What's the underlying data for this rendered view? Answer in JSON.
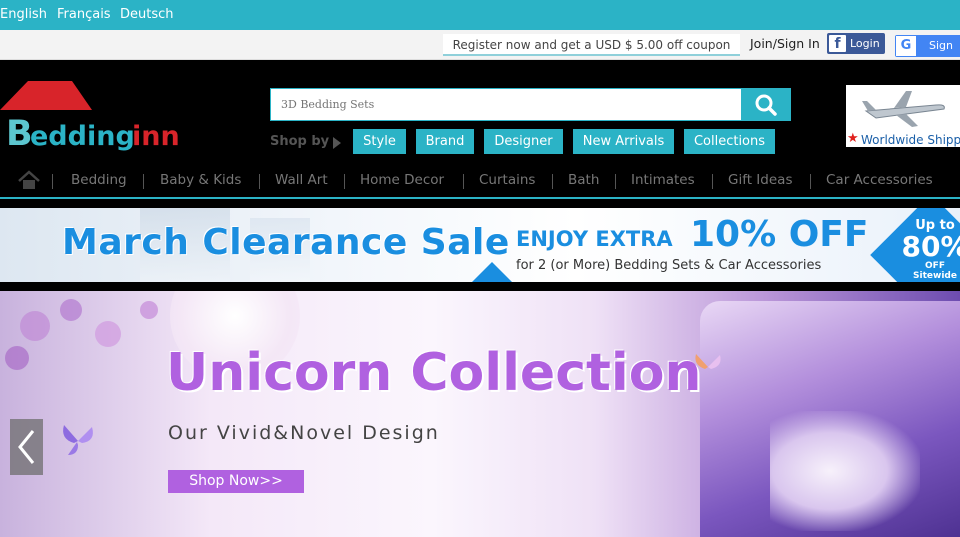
{
  "languages": [
    "English",
    "Français",
    "Deutsch"
  ],
  "topbar": {
    "coupon_text": "Register now and get a USD $ 5.00 off coupon",
    "join_signin": "Join/Sign In",
    "facebook_login": "Login",
    "google_signin": "Sign in"
  },
  "header": {
    "logo_text": "Beddinginn",
    "search_placeholder": "3D Bedding Sets",
    "shop_by_label": "Shop by",
    "shop_by_buttons": [
      "Style",
      "Brand",
      "Designer",
      "New Arrivals",
      "Collections"
    ],
    "shipping_text": "Worldwide Shipping"
  },
  "nav": {
    "items": [
      "Bedding",
      "Baby & Kids",
      "Wall Art",
      "Home Decor",
      "Curtains",
      "Bath",
      "Intimates",
      "Gift Ideas",
      "Car Accessories"
    ]
  },
  "promo": {
    "title": "March Clearance Sale",
    "enjoy": "ENJOY EXTRA",
    "percent": "10% OFF",
    "subtitle": "for 2 (or More) Bedding Sets & Car Accessories",
    "badge_upto": "Up to",
    "badge_value": "80%",
    "badge_off": "OFF",
    "badge_sitewide": "Sitewide"
  },
  "hero": {
    "title": "Unicorn Collection",
    "subtitle": "Our Vivid&Novel Design",
    "button": "Shop Now>>"
  },
  "colors": {
    "accent": "#2bb3c6",
    "promo_blue": "#1a8ee0",
    "hero_purple": "#b061e0"
  }
}
